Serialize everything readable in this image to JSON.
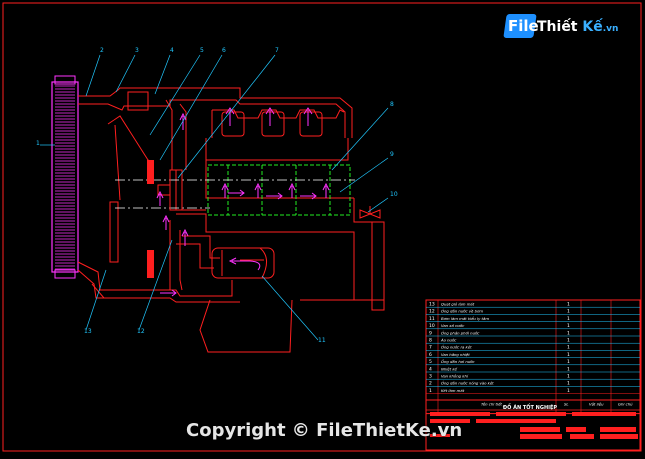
{
  "watermark": {
    "logo_file": "File",
    "logo_thiet": "Thiết",
    "logo_ke": "Kế",
    "logo_vn": ".vn",
    "copyright": "Copyright © FileThietKe.vn"
  },
  "title_block": {
    "project_title": "ĐỒ ÁN TỐT NGHIỆP"
  },
  "callouts": [
    "1",
    "2",
    "3",
    "4",
    "5",
    "6",
    "7",
    "8",
    "9",
    "10",
    "11",
    "12",
    "13"
  ],
  "parts_table": {
    "rows": [
      {
        "no": "13",
        "name": "Quạt gió làm mát",
        "qty": "1"
      },
      {
        "no": "12",
        "name": "Ống dẫn nước về bơm",
        "qty": "1"
      },
      {
        "no": "11",
        "name": "Bơm làm mát kiểu ly tâm",
        "qty": "1"
      },
      {
        "no": "10",
        "name": "Van xả nước",
        "qty": "1"
      },
      {
        "no": "9",
        "name": "Ống phân phối nước",
        "qty": "1"
      },
      {
        "no": "8",
        "name": "Áo nước",
        "qty": "1"
      },
      {
        "no": "7",
        "name": "Ống nước ra két",
        "qty": "1"
      },
      {
        "no": "6",
        "name": "Van hằng nhiệt",
        "qty": "1"
      },
      {
        "no": "5",
        "name": "Ống dẫn hơi nước",
        "qty": "1"
      },
      {
        "no": "4",
        "name": "Nhiệt kế",
        "qty": "1"
      },
      {
        "no": "3",
        "name": "Van không khí",
        "qty": "1"
      },
      {
        "no": "2",
        "name": "Ống dẫn nước nóng vào két",
        "qty": "1"
      },
      {
        "no": "1",
        "name": "Két làm mát",
        "qty": "1"
      }
    ],
    "footer": {
      "col_name": "Tên chi tiết",
      "col_qty": "SL",
      "col_material": "Vật liệu",
      "col_note": "Ghi chú"
    }
  },
  "colors": {
    "outline": "#ff1f1f",
    "radiator": "#ff33ff",
    "leaders": "#20c8ff",
    "water_jacket": "#22ee22",
    "flow_arrows": "#ff33ff",
    "centerline": "#ffffff",
    "fan": "#ff1f1f"
  }
}
